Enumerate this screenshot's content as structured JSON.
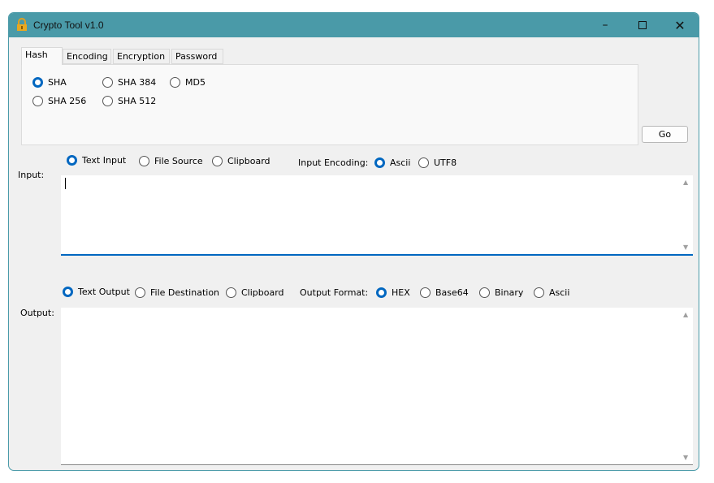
{
  "window": {
    "title": "Crypto Tool v1.0",
    "accent": "#4a9aa8"
  },
  "tabs": [
    {
      "label": "Hash",
      "active": true
    },
    {
      "label": "Encoding"
    },
    {
      "label": "Encryption"
    },
    {
      "label": "Password"
    }
  ],
  "hash": {
    "options": [
      {
        "label": "SHA",
        "checked": true
      },
      {
        "label": "SHA 384"
      },
      {
        "label": "MD5"
      },
      {
        "label": "SHA 256"
      },
      {
        "label": "SHA 512"
      }
    ]
  },
  "go_label": "Go",
  "input": {
    "label": "Input:",
    "sources": [
      {
        "label": "Text Input",
        "checked": true
      },
      {
        "label": "File Source"
      },
      {
        "label": "Clipboard"
      }
    ],
    "encoding_label": "Input Encoding:",
    "encodings": [
      {
        "label": "Ascii",
        "checked": true
      },
      {
        "label": "UTF8"
      }
    ],
    "value": ""
  },
  "output": {
    "label": "Output:",
    "destinations": [
      {
        "label": "Text Output",
        "checked": true
      },
      {
        "label": "File Destination"
      },
      {
        "label": "Clipboard"
      }
    ],
    "format_label": "Output Format:",
    "formats": [
      {
        "label": "HEX",
        "checked": true
      },
      {
        "label": "Base64"
      },
      {
        "label": "Binary"
      },
      {
        "label": "Ascii"
      }
    ],
    "value": ""
  }
}
